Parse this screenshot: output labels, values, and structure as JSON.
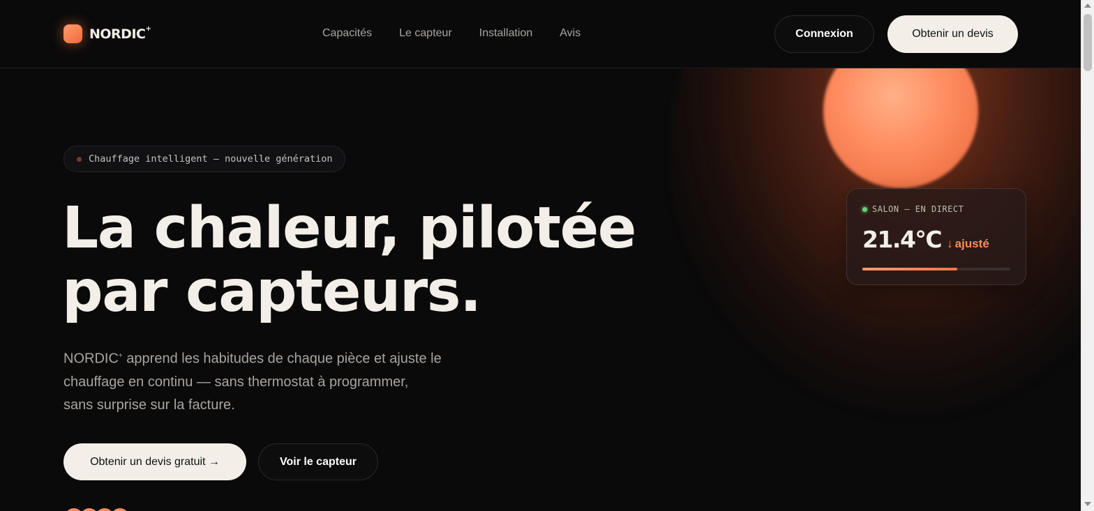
{
  "brand": {
    "name": "NORDIC",
    "superscript": "+"
  },
  "nav": {
    "items": [
      {
        "label": "Capacités"
      },
      {
        "label": "Le capteur"
      },
      {
        "label": "Installation"
      },
      {
        "label": "Avis"
      }
    ]
  },
  "header": {
    "login_label": "Connexion",
    "quote_label": "Obtenir un devis"
  },
  "hero": {
    "badge": "Chauffage intelligent — nouvelle génération",
    "title_line1": "La chaleur, pilotée",
    "title_line2": "par capteurs.",
    "subtitle_brand": "NORDIC",
    "subtitle_sup": "+",
    "subtitle_line1": " apprend les habitudes de chaque pièce et ajuste le",
    "subtitle_line2": "chauffage en continu — sans thermostat à programmer,",
    "subtitle_line3": "sans surprise sur la facture.",
    "cta_primary": "Obtenir un devis gratuit →",
    "cta_secondary": "Voir le capteur"
  },
  "live_card": {
    "label": "SALON — EN DIRECT",
    "temperature": "21.4°C",
    "delta_arrow": "↓",
    "delta_label": "ajusté",
    "progress": 0.64,
    "status_color": "#6bd37a",
    "accent_color": "#ff8a5a"
  },
  "colors": {
    "background": "#0a0a0b",
    "text": "#f3efe8",
    "muted": "#a9a5a0",
    "accent": "#f2764a"
  }
}
